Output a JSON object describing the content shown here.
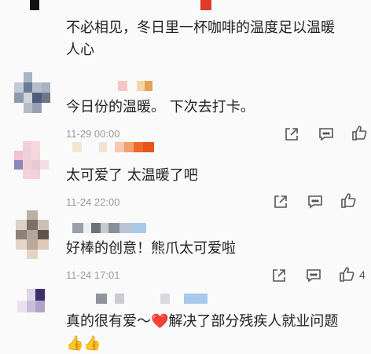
{
  "comments": [
    {
      "text_line1": "不必相见，冬日里一杯咖啡的温度足以温暖",
      "text_line2": "人心"
    },
    {
      "text": "今日份的温暖。 下次去打卡。",
      "time": "11-29 00:00"
    },
    {
      "text": "太可爱了 太温暖了吧",
      "time": "11-24 22:00"
    },
    {
      "text": "好棒的创意！熊爪太可爱啦",
      "time": "11-24 17:01",
      "likes": "4"
    },
    {
      "text_before": "真的很有爱～",
      "heart": "❤️",
      "text_after": "解决了部分残疾人就业问题",
      "emoji_line": "👍👍"
    }
  ],
  "icons": {
    "share": "share-icon",
    "comment": "comment-icon",
    "like": "thumbs-up-icon"
  },
  "colors": {
    "meta_text": "#9a9a9a",
    "body_text": "#222222",
    "heart": "#e53935",
    "background": "#fafafa"
  }
}
